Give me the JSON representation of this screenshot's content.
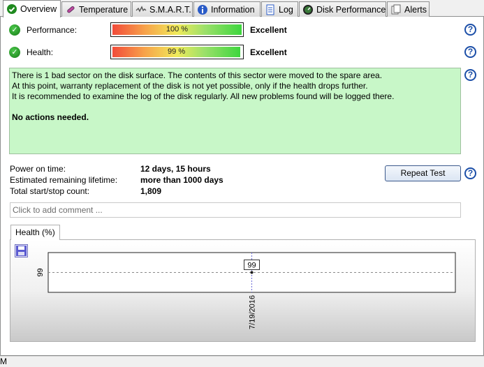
{
  "tabs": [
    {
      "label": "Overview",
      "icon": "check-circle-icon"
    },
    {
      "label": "Temperature",
      "icon": "thermometer-icon"
    },
    {
      "label": "S.M.A.R.T.",
      "icon": "smart-icon"
    },
    {
      "label": "Information",
      "icon": "info-icon"
    },
    {
      "label": "Log",
      "icon": "log-icon"
    },
    {
      "label": "Disk Performance",
      "icon": "speedometer-icon"
    },
    {
      "label": "Alerts",
      "icon": "alerts-icon"
    }
  ],
  "performance": {
    "label": "Performance:",
    "value": "100 %",
    "percent": 100,
    "rating": "Excellent"
  },
  "health": {
    "label": "Health:",
    "value": "99 %",
    "percent": 99,
    "rating": "Excellent"
  },
  "message": {
    "lines": [
      "There is 1 bad sector on the disk surface. The contents of this sector were moved to the spare area.",
      "At this point, warranty replacement of the disk is not yet possible, only if the health drops further.",
      "It is recommended to examine the log of the disk regularly. All new problems found will be logged there."
    ],
    "conclusion": "No actions needed."
  },
  "info": [
    {
      "label": "Power on time:",
      "value": "12 days, 15 hours"
    },
    {
      "label": "Estimated remaining lifetime:",
      "value": "more than 1000 days"
    },
    {
      "label": "Total start/stop count:",
      "value": "1,809"
    }
  ],
  "repeat_test_label": "Repeat Test",
  "comment_placeholder": "Click to add comment ...",
  "chart_tab_label": "Health (%)",
  "help_glyph": "?",
  "check_glyph": "✓",
  "status_text": "M",
  "chart_data": {
    "type": "line",
    "x": [
      "7/19/2016"
    ],
    "series": [
      {
        "values": [
          99
        ]
      }
    ],
    "data_labels": [
      "99"
    ],
    "ytick_labels": [
      "99"
    ],
    "grid": true
  }
}
